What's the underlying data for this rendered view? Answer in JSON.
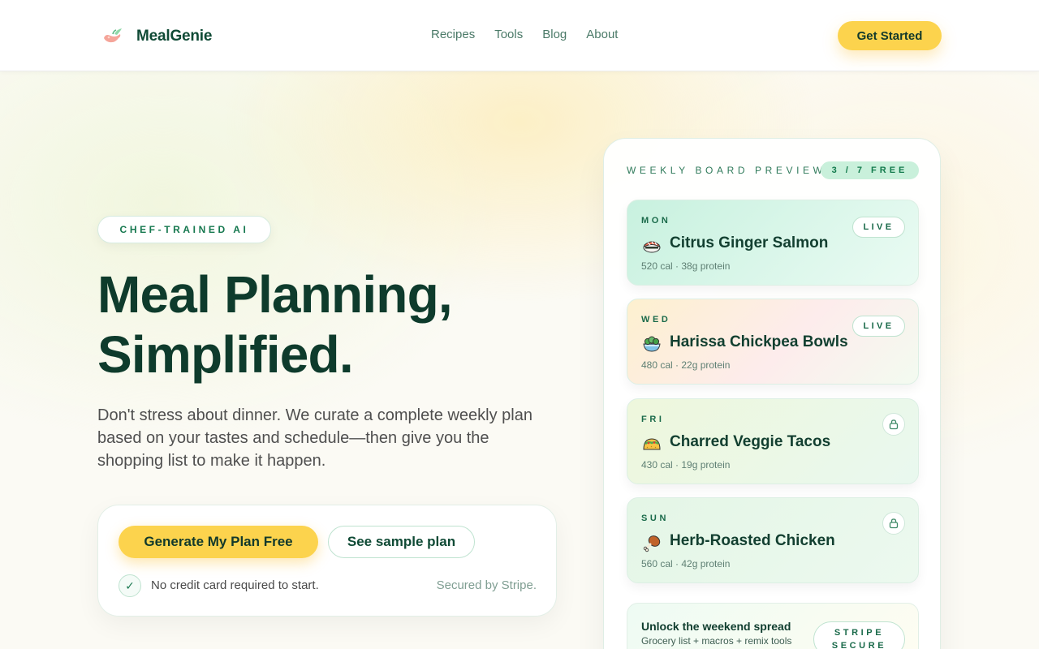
{
  "brand": {
    "name": "MealGenie",
    "icon": "genie-lamp-icon"
  },
  "nav": {
    "items": [
      "Recipes",
      "Tools",
      "Blog",
      "About"
    ]
  },
  "header": {
    "cta_label": "Get Started"
  },
  "hero": {
    "badge": "CHEF-TRAINED AI",
    "title_line1": "Meal Planning,",
    "title_line2": "Simplified.",
    "subtitle": "Don't stress about dinner. We curate a complete weekly plan based on your tastes and schedule—then give you the shopping list to make it happen.",
    "primary_button": "Generate My Plan Free",
    "secondary_button": "See sample plan",
    "note": "No credit card required to start.",
    "secured": "Secured by Stripe."
  },
  "board": {
    "title": "WEEKLY BOARD PREVIEW",
    "count": "3 / 7 FREE",
    "days": [
      {
        "day": "MON",
        "meal": "Citrus Ginger Salmon",
        "stats": "520 cal · 38g protein",
        "status": "LIVE",
        "icon": "sushi-icon"
      },
      {
        "day": "WED",
        "meal": "Harissa Chickpea Bowls",
        "stats": "480 cal · 22g protein",
        "status": "LIVE",
        "icon": "salad-bowl-icon"
      },
      {
        "day": "FRI",
        "meal": "Charred Veggie Tacos",
        "stats": "430 cal · 19g protein",
        "status": "locked",
        "icon": "taco-icon"
      },
      {
        "day": "SUN",
        "meal": "Herb-Roasted Chicken",
        "stats": "560 cal · 42g protein",
        "status": "locked",
        "icon": "drumstick-icon"
      }
    ],
    "unlock": {
      "title": "Unlock the weekend spread",
      "subtitle": "Grocery list + macros + remix tools",
      "badge": "STRIPE SECURE"
    }
  },
  "colors": {
    "accent": "#fcd34d",
    "brand_green": "#0f4a35",
    "mint": "#c9f0db"
  }
}
